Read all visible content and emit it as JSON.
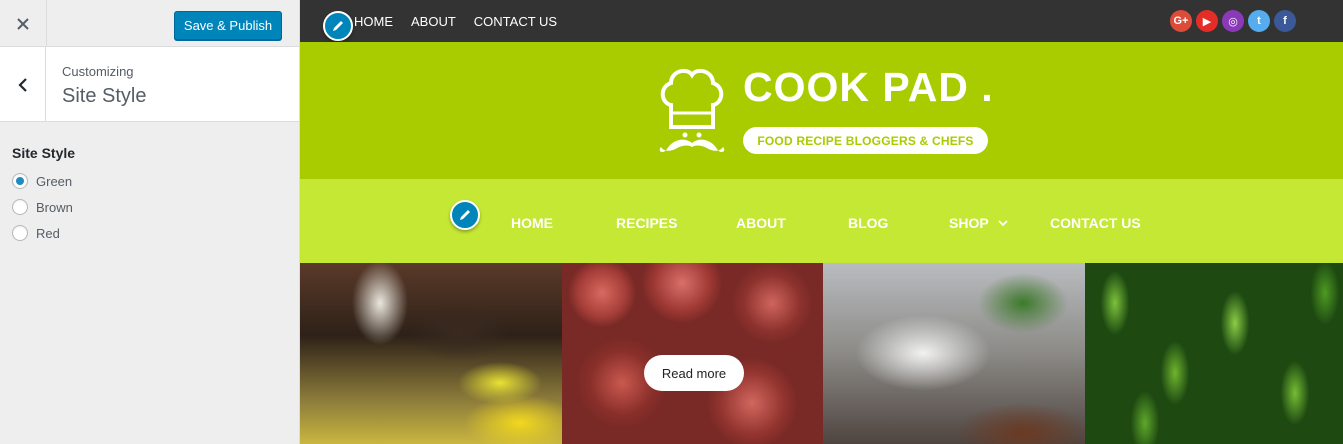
{
  "customizer": {
    "close_label": "×",
    "save_label": "Save & Publish",
    "section_parent": "Customizing",
    "section_title": "Site Style",
    "control": {
      "title": "Site Style",
      "options": [
        {
          "label": "Green",
          "checked": true
        },
        {
          "label": "Brown",
          "checked": false
        },
        {
          "label": "Red",
          "checked": false
        }
      ]
    }
  },
  "preview": {
    "top_nav": [
      "HOME",
      "ABOUT",
      "CONTACT US"
    ],
    "social": [
      {
        "name": "google-plus",
        "glyph": "G+",
        "color": "#dd4b39"
      },
      {
        "name": "youtube",
        "glyph": "▶",
        "color": "#e52d27"
      },
      {
        "name": "instagram",
        "glyph": "◎",
        "color": "#8a3ab9"
      },
      {
        "name": "twitter",
        "glyph": "t",
        "color": "#55acee"
      },
      {
        "name": "facebook",
        "glyph": "f",
        "color": "#3b5998"
      }
    ],
    "site_title": "COOK PAD .",
    "site_tagline": "FOOD RECIPE BLOGGERS & CHEFS",
    "main_nav": [
      "HOME",
      "RECIPES",
      "ABOUT",
      "BLOG",
      "SHOP",
      "CONTACT US"
    ],
    "read_more": "Read more",
    "colors": {
      "brand": "#a8cc00",
      "nav": "#c5e834",
      "topbar": "#333333",
      "accent_button": "#0085ba"
    }
  }
}
